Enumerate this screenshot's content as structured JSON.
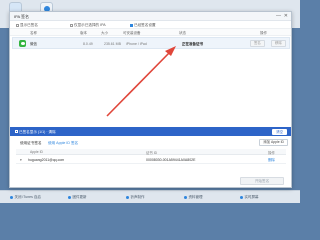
{
  "dialog": {
    "title": "IPA 签名",
    "toolbar": {
      "items": [
        "显示已签名",
        "仅显示已选择的 IPA",
        "已经签名设置"
      ]
    },
    "table": {
      "headers": {
        "name": "名称",
        "version": "版本",
        "size": "大小",
        "platform": "可安装设备",
        "status": "状态",
        "operation": "操作"
      },
      "rows": [
        {
          "name": "微信",
          "version": "8.0.49",
          "size": "235.61 MB",
          "platform": "iPhone / iPad",
          "status": "正在准备证书",
          "buttons": [
            "签名",
            "移除"
          ]
        }
      ]
    },
    "footer_bar": {
      "checkbox_label": "已签名显示 (1/1) · 清除",
      "button": "清空"
    },
    "accounts": {
      "title": "使用证书签名",
      "link": "使用 Apple ID 签名",
      "add_button": "添加 Apple ID",
      "headers": {
        "apple_id": "Apple ID",
        "id": "证书 ID",
        "operation": "操作"
      },
      "rows": [
        {
          "caret": "▾",
          "email": "huguang2011@qq.com",
          "id": "00008030-001A59441A0A802E",
          "operation": "删除"
        }
      ]
    },
    "start_button": "开始签名"
  },
  "background_app": {
    "bottom_items": [
      "关闭 iTunes 自启",
      "固件更新",
      "铃声制作",
      "资料管理",
      "实时屏幕"
    ]
  },
  "colors": {
    "accent": "#2d64c8",
    "arrow": "#e0463a",
    "wechat": "#33b440"
  },
  "icons": {
    "minimize": "—",
    "close": "✕"
  }
}
